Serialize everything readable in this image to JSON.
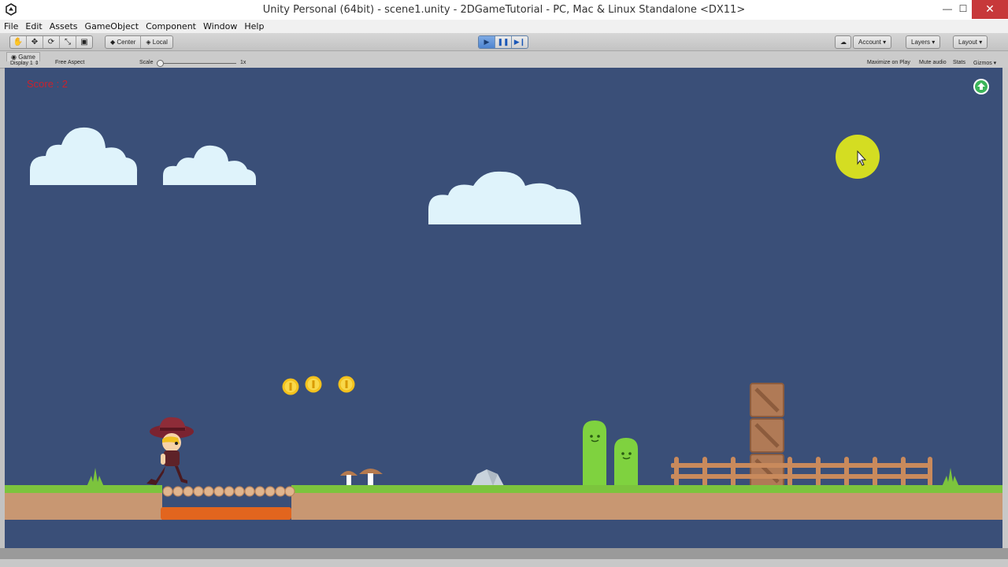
{
  "window": {
    "title": "Unity Personal (64bit) - scene1.unity - 2DGameTutorial - PC, Mac & Linux Standalone <DX11>",
    "minimize": "—",
    "maximize": "☐",
    "close": "✕"
  },
  "menu": {
    "items": [
      "File",
      "Edit",
      "Assets",
      "GameObject",
      "Component",
      "Window",
      "Help"
    ]
  },
  "toolbar": {
    "tools": [
      "hand-icon",
      "move-icon",
      "rotate-icon",
      "scale-icon",
      "rect-icon"
    ],
    "pivot": {
      "center": "Center",
      "local": "Local"
    },
    "playback": [
      "play-icon",
      "pause-icon",
      "step-icon"
    ],
    "account_label": "Account",
    "layers_label": "Layers",
    "layout_label": "Layout"
  },
  "game_tab": {
    "title": "Game",
    "display": "Display 1",
    "aspect": "Free Aspect",
    "scale_label": "Scale",
    "scale_value": "1x",
    "maximize_on_play": "Maximize on Play",
    "mute_audio": "Mute audio",
    "stats": "Stats",
    "gizmos": "Gizmos"
  },
  "game": {
    "score_text": "Score : 2",
    "sky_color": "#3a4f78",
    "coin_count_visible": 3
  },
  "colors": {
    "accent": "#4d84d0",
    "score": "#c8222e",
    "grass": "#7cc43d",
    "dirt": "#c89772",
    "lava": "#e2651e"
  }
}
